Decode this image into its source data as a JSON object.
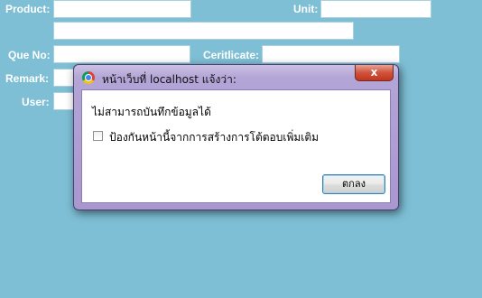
{
  "form": {
    "product_label": "Product:",
    "unit_label": "Unit:",
    "queue_label": "Que No:",
    "certificate_label": "Ceritlicate:",
    "remark_label": "Remark:",
    "user_label": "User:"
  },
  "dialog": {
    "title": "หน้าเว็บที่ localhost แจ้งว่า:",
    "close_label": "x",
    "message": "ไม่สามารถบันทึกข้อมูลได้",
    "checkbox_label": "ป้องกันหน้านี้จากการสร้างการโต้ตอบเพิ่มเติม",
    "ok_label": "ตกลง"
  },
  "colors": {
    "background": "#7ebfd5",
    "dialog_frame": "#a997cf",
    "close_button": "#c2361f",
    "ok_button_border": "#3c7fb1"
  },
  "icons": {
    "browser": "chrome-icon",
    "close": "close-icon"
  }
}
